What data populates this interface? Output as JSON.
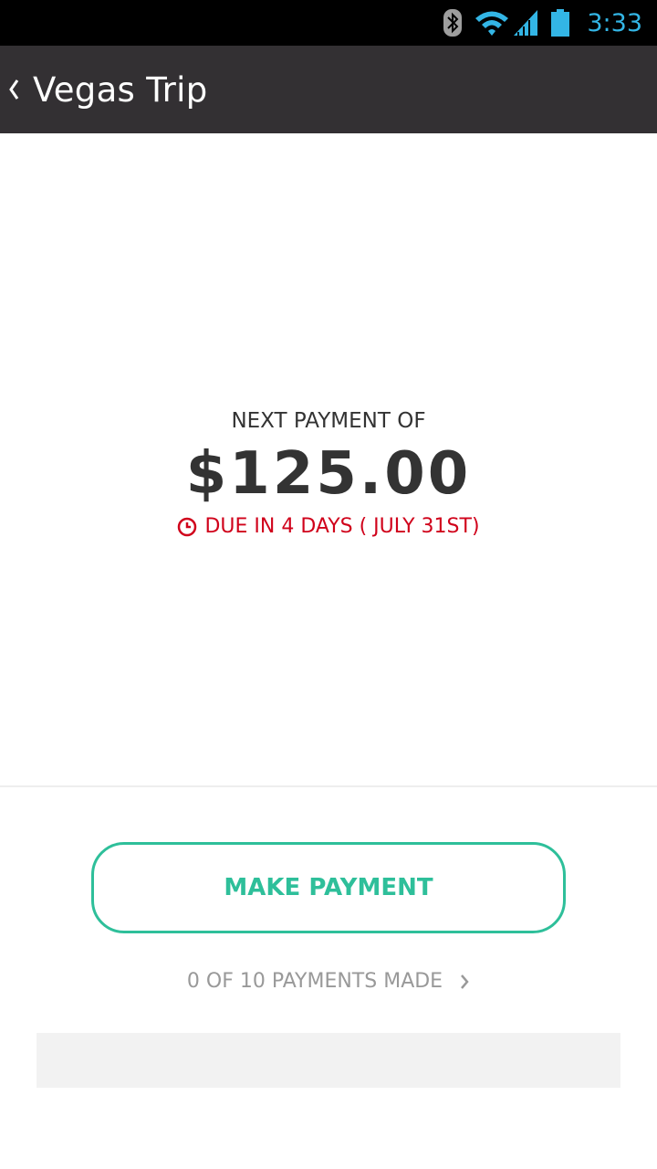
{
  "status_bar": {
    "time": "3:33",
    "icons": [
      "bluetooth-icon",
      "wifi-icon",
      "signal-icon",
      "battery-icon"
    ],
    "icon_color": "#ffffff",
    "time_color": "#33b5e5"
  },
  "app_bar": {
    "title": "Vegas Trip",
    "back_icon": "chevron-left-icon",
    "background": "#333033"
  },
  "payment": {
    "label": "NEXT PAYMENT OF",
    "amount": "$125.00",
    "due_text": "DUE IN 4 DAYS ( JULY 31ST)",
    "due_icon": "clock-icon",
    "due_color": "#d0021b"
  },
  "actions": {
    "make_payment_label": "MAKE PAYMENT",
    "accent_color": "#2ebf9a",
    "progress_text": "0 OF 10 PAYMENTS MADE",
    "progress_icon": "chevron-right-icon",
    "payments_made": 0,
    "payments_total": 10
  }
}
